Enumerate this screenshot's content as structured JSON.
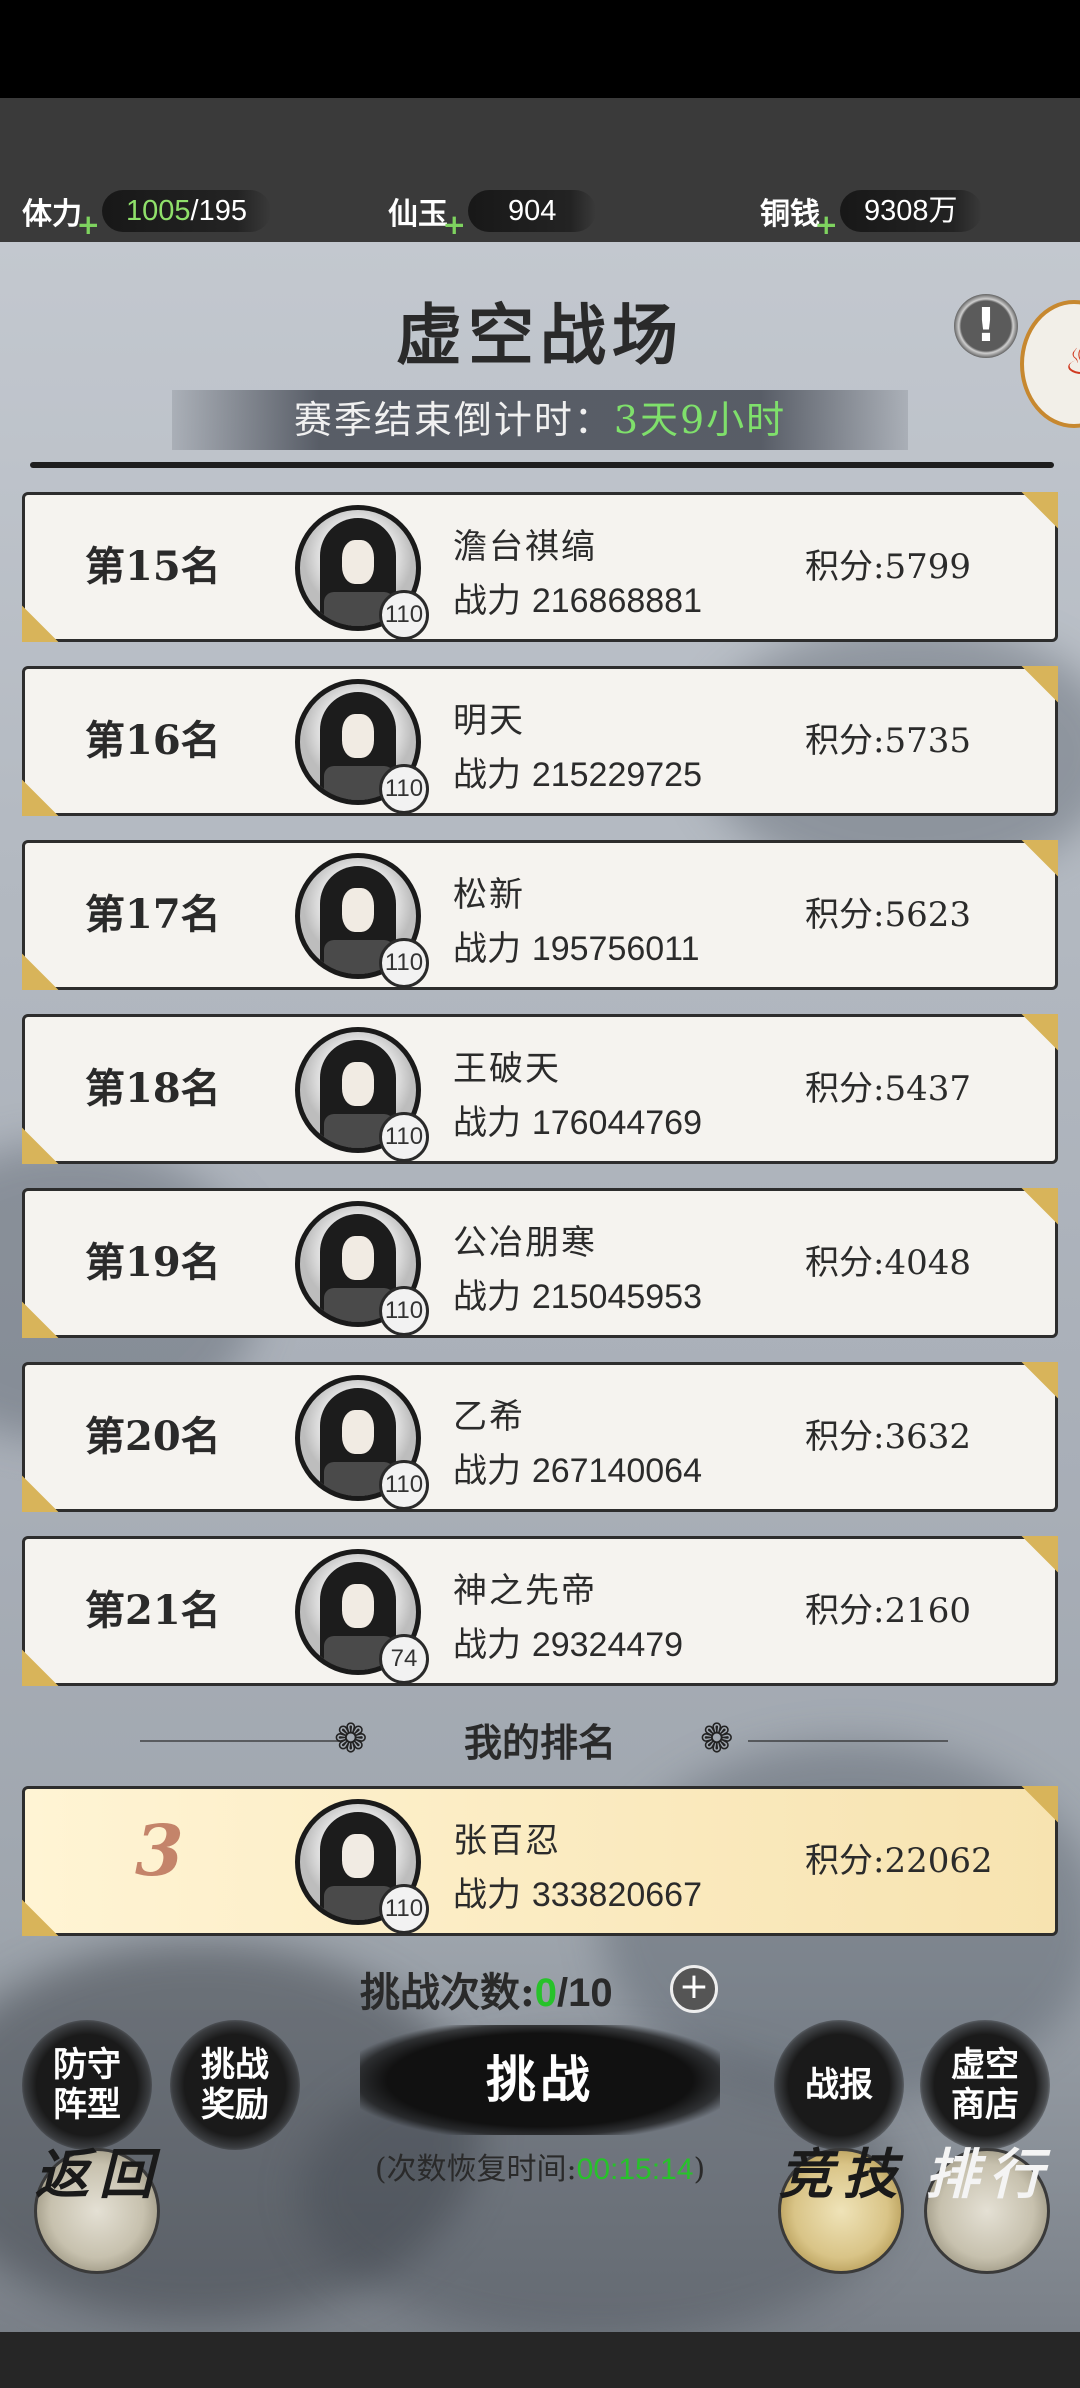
{
  "resources": {
    "stamina": {
      "label": "体力",
      "current": "1005",
      "max": "/195"
    },
    "jade": {
      "label": "仙玉",
      "value": "904"
    },
    "coins": {
      "label": "铜钱",
      "value": "9308万"
    }
  },
  "header": {
    "title": "虚空战场",
    "countdown_label": "赛季结束倒计时：",
    "countdown_value": "3天9小时"
  },
  "ranking": [
    {
      "rank": "第15名",
      "name": "澹台祺缟",
      "power_label": "战力",
      "power": "216868881",
      "level": "110",
      "score": "积分:5799"
    },
    {
      "rank": "第16名",
      "name": "明天",
      "power_label": "战力",
      "power": "215229725",
      "level": "110",
      "score": "积分:5735"
    },
    {
      "rank": "第17名",
      "name": "松新",
      "power_label": "战力",
      "power": "195756011",
      "level": "110",
      "score": "积分:5623"
    },
    {
      "rank": "第18名",
      "name": "王破天",
      "power_label": "战力",
      "power": "176044769",
      "level": "110",
      "score": "积分:5437"
    },
    {
      "rank": "第19名",
      "name": "公冶朋寒",
      "power_label": "战力",
      "power": "215045953",
      "level": "110",
      "score": "积分:4048"
    },
    {
      "rank": "第20名",
      "name": "乙希",
      "power_label": "战力",
      "power": "267140064",
      "level": "110",
      "score": "积分:3632"
    },
    {
      "rank": "第21名",
      "name": "神之先帝",
      "power_label": "战力",
      "power": "29324479",
      "level": "74",
      "score": "积分:2160"
    }
  ],
  "my_rank": {
    "section_title": "我的排名",
    "rank": "3",
    "name": "张百忍",
    "power_label": "战力",
    "power": "333820667",
    "level": "110",
    "score": "积分:22062"
  },
  "challenge": {
    "count_label": "挑战次数:",
    "count_used": "0",
    "count_max": "/10",
    "button": "挑战",
    "recover_prefix": "(次数恢复时间:",
    "recover_time": "00:15:14",
    "recover_suffix": ")"
  },
  "buttons": {
    "defense": "防守阵型",
    "reward": "挑战奖励",
    "report": "战报",
    "shop": "虚空商店",
    "back": "返回",
    "arena": "竞技",
    "leaderboard": "排行"
  },
  "icons": {
    "info": "exclamation-icon",
    "plus": "plus-icon"
  }
}
